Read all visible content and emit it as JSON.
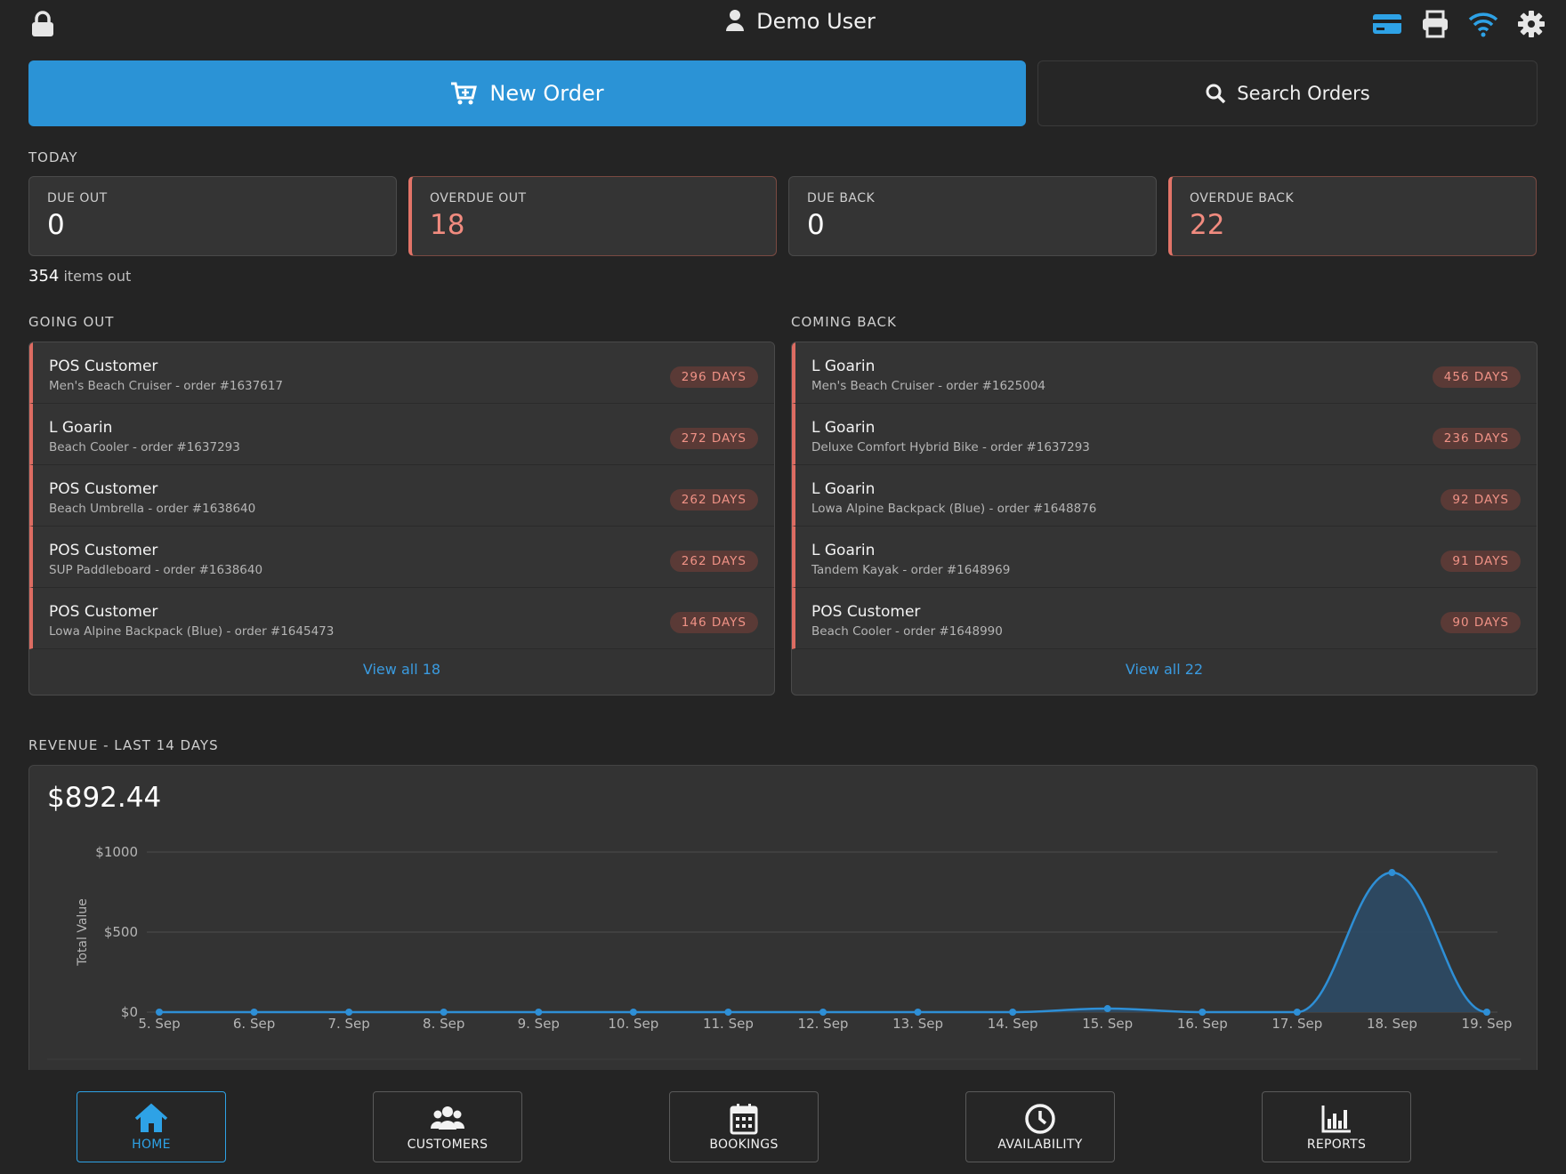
{
  "header": {
    "user_name": "Demo User",
    "accent_color": "#2ea2e6",
    "icons": [
      "lock-icon",
      "user-icon",
      "card-reader-icon",
      "printer-icon",
      "wifi-icon",
      "gear-icon"
    ]
  },
  "actions": {
    "new_order_label": "New Order",
    "search_orders_label": "Search Orders"
  },
  "today": {
    "title": "TODAY",
    "stats": [
      {
        "label": "DUE OUT",
        "value": "0",
        "alert": false
      },
      {
        "label": "OVERDUE OUT",
        "value": "18",
        "alert": true
      },
      {
        "label": "DUE BACK",
        "value": "0",
        "alert": false
      },
      {
        "label": "OVERDUE BACK",
        "value": "22",
        "alert": true
      }
    ],
    "items_out_count": "354",
    "items_out_label": "items out"
  },
  "going_out": {
    "title": "GOING OUT",
    "rows": [
      {
        "name": "POS Customer",
        "detail": "Men's Beach Cruiser - order #1637617",
        "badge": "296 DAYS"
      },
      {
        "name": "L Goarin",
        "detail": "Beach Cooler - order #1637293",
        "badge": "272 DAYS"
      },
      {
        "name": "POS Customer",
        "detail": "Beach Umbrella - order #1638640",
        "badge": "262 DAYS"
      },
      {
        "name": "POS Customer",
        "detail": "SUP Paddleboard - order #1638640",
        "badge": "262 DAYS"
      },
      {
        "name": "POS Customer",
        "detail": "Lowa Alpine Backpack (Blue) - order #1645473",
        "badge": "146 DAYS"
      }
    ],
    "view_all": "View all 18"
  },
  "coming_back": {
    "title": "COMING BACK",
    "rows": [
      {
        "name": "L Goarin",
        "detail": "Men's Beach Cruiser - order #1625004",
        "badge": "456 DAYS"
      },
      {
        "name": "L Goarin",
        "detail": "Deluxe Comfort Hybrid Bike - order #1637293",
        "badge": "236 DAYS"
      },
      {
        "name": "L Goarin",
        "detail": "Lowa Alpine Backpack (Blue) - order #1648876",
        "badge": "92 DAYS"
      },
      {
        "name": "L Goarin",
        "detail": "Tandem Kayak - order #1648969",
        "badge": "91 DAYS"
      },
      {
        "name": "POS Customer",
        "detail": "Beach Cooler - order #1648990",
        "badge": "90 DAYS"
      }
    ],
    "view_all": "View all 22"
  },
  "revenue": {
    "title": "REVENUE - LAST 14 DAYS",
    "total": "$892.44"
  },
  "chart_data": {
    "type": "area",
    "title": "",
    "xlabel": "",
    "ylabel": "Total Value",
    "categories": [
      "5. Sep",
      "6. Sep",
      "7. Sep",
      "8. Sep",
      "9. Sep",
      "10. Sep",
      "11. Sep",
      "12. Sep",
      "13. Sep",
      "14. Sep",
      "15. Sep",
      "16. Sep",
      "17. Sep",
      "18. Sep",
      "19. Sep"
    ],
    "series": [
      {
        "values": [
          0,
          0,
          0,
          0,
          0,
          0,
          0,
          0,
          0,
          0,
          22,
          0,
          0,
          872,
          0
        ]
      }
    ],
    "y_ticks": [
      "$0",
      "$500",
      "$1000"
    ],
    "ylim": [
      0,
      1000
    ],
    "grid": true,
    "legend": "none",
    "line_color": "#2e8fd6",
    "fill_color": "#2d4a63"
  },
  "nav": {
    "items": [
      {
        "label": "HOME",
        "icon": "home-icon",
        "active": true
      },
      {
        "label": "CUSTOMERS",
        "icon": "customers-icon",
        "active": false
      },
      {
        "label": "BOOKINGS",
        "icon": "calendar-icon",
        "active": false
      },
      {
        "label": "AVAILABILITY",
        "icon": "clock-icon",
        "active": false
      },
      {
        "label": "REPORTS",
        "icon": "bar-chart-icon",
        "active": false
      }
    ]
  }
}
